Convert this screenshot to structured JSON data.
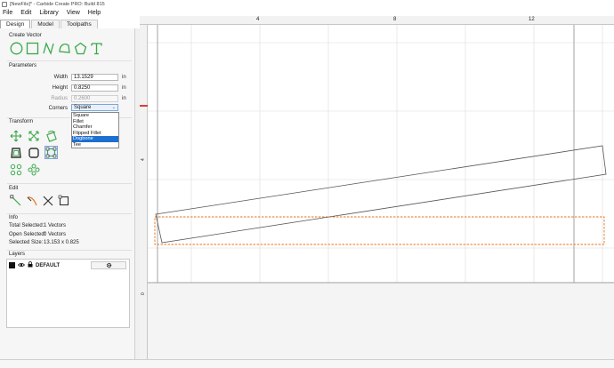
{
  "window": {
    "title": "[NewFile]* - Carbide Create PRO: Build 815"
  },
  "menu": {
    "items": [
      "File",
      "Edit",
      "Library",
      "View",
      "Help"
    ]
  },
  "tabs": [
    {
      "label": "Design",
      "active": true
    },
    {
      "label": "Model",
      "active": false
    },
    {
      "label": "Toolpaths",
      "active": false
    }
  ],
  "create_vector": {
    "title": "Create Vector",
    "tools": [
      "circle-icon",
      "rectangle-icon",
      "curve-icon",
      "polyline-icon",
      "polygon-icon",
      "text-icon"
    ]
  },
  "parameters": {
    "title": "Parameters",
    "width": {
      "label": "Width",
      "value": "13.1529",
      "unit": "in"
    },
    "height": {
      "label": "Height",
      "value": "0.8250",
      "unit": "in"
    },
    "radius": {
      "label": "Radius",
      "value": "0.2600",
      "unit": "in"
    },
    "corners": {
      "label": "Corners",
      "value": "Square",
      "options": [
        "Square",
        "Fillet",
        "Chamfer",
        "Flipped Fillet",
        "Dogbone",
        "Tee"
      ],
      "highlighted": "Dogbone"
    }
  },
  "transform": {
    "title": "Transform"
  },
  "edit": {
    "title": "Edit"
  },
  "info": {
    "title": "Info",
    "total_selected_label": "Total Selected:",
    "total_selected_value": "1 Vectors",
    "open_selected_label": "Open Selected:",
    "open_selected_value": "0 Vectors",
    "selected_size_label": "Selected Size:",
    "selected_size_value": "13.153 x 0.825"
  },
  "layers": {
    "title": "Layers",
    "items": [
      {
        "name": "DEFAULT",
        "color": "#111111"
      }
    ]
  },
  "rulers": {
    "horizontal_labels": [
      "4",
      "8",
      "12"
    ],
    "vertical_labels": [
      "4",
      "0"
    ]
  },
  "colors": {
    "vector_green": "#39a84a",
    "selection_orange": "#e8731a",
    "dropdown_highlight": "#1e6fd0",
    "ruler_marker": "#e03a3a"
  }
}
